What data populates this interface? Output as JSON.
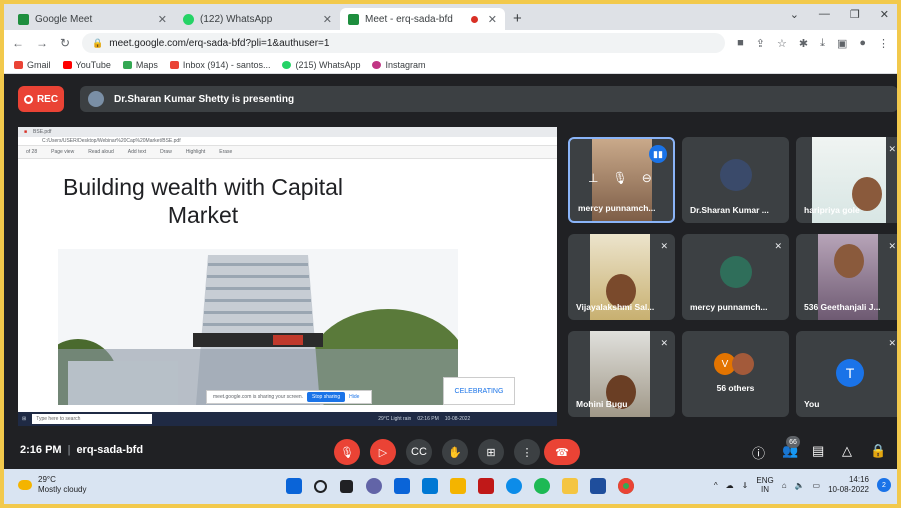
{
  "browser": {
    "tabs": [
      {
        "title": "Google Meet",
        "fav_color": "#1e8e3e"
      },
      {
        "title": "(122) WhatsApp",
        "fav_color": "#25d366"
      },
      {
        "title": "Meet - erq-sada-bfd",
        "fav_color": "#1e8e3e"
      }
    ],
    "url": "meet.google.com/erq-sada-bfd?pli=1&authuser=1",
    "bookmarks": [
      {
        "label": "Gmail",
        "color": "#ea4335"
      },
      {
        "label": "YouTube",
        "color": "#ff0000"
      },
      {
        "label": "Maps",
        "color": "#34a853"
      },
      {
        "label": "Inbox (914) - santos...",
        "color": "#ea4335"
      },
      {
        "label": "(215) WhatsApp",
        "color": "#25d366"
      },
      {
        "label": "Instagram",
        "color": "#c13584"
      }
    ]
  },
  "meet": {
    "rec_label": "REC",
    "presenting_text": "Dr.Sharan Kumar Shetty is presenting",
    "meeting_time": "2:16 PM",
    "meeting_code": "erq-sada-bfd",
    "participant_count": "66",
    "tiles": [
      {
        "name": "mercy punnamch..."
      },
      {
        "name": "Dr.Sharan Kumar ..."
      },
      {
        "name": "haripriya gole"
      },
      {
        "name": "Vijayalakshmi Sal..."
      },
      {
        "name": "mercy punnamch..."
      },
      {
        "name": "536 Geethanjali J..."
      },
      {
        "name": "Mohini Bugu"
      },
      {
        "name": "56 others",
        "avatar_letter": "V"
      },
      {
        "name": "You",
        "avatar_letter": "T"
      }
    ]
  },
  "shared_screen": {
    "tab_title": "BSE.pdf",
    "file_path": "C:/Users/USER/Desktop/Webinar%20Cap%20Market/BSE.pdf",
    "page_indicator": "of 28",
    "toolbar_items": [
      "Page view",
      "Read aloud",
      "Add text",
      "Draw",
      "Highlight",
      "Erase"
    ],
    "slide_title": "Building wealth with Capital Market",
    "overlay_logo": "CELEBRATING",
    "sharing_notice": "meet.google.com is sharing your screen.",
    "stop_sharing": "Stop sharing",
    "hide": "Hide",
    "search_placeholder": "Type here to search",
    "weather": "29°C  Light rain",
    "time": "02:16 PM",
    "date": "10-08-2022"
  },
  "taskbar": {
    "temp": "29°C",
    "condition": "Mostly cloudy",
    "lang_top": "ENG",
    "lang_bottom": "IN",
    "clock_time": "14:16",
    "clock_date": "10-08-2022",
    "notifications": "2"
  }
}
